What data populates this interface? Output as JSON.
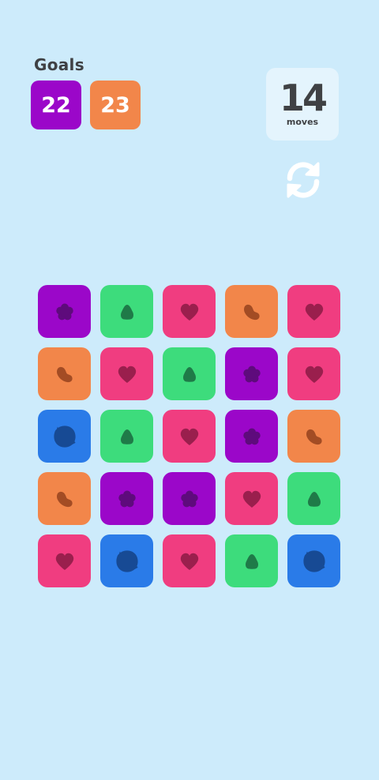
{
  "goals": {
    "label": "Goals",
    "items": [
      {
        "value": "22",
        "color": "#9b07c9"
      },
      {
        "value": "23",
        "color": "#f2864a"
      }
    ]
  },
  "moves": {
    "count": "14",
    "label": "moves"
  },
  "restart": {
    "icon": "restart-icon"
  },
  "colors": {
    "purple": "#9b07c9",
    "green": "#3ddc7c",
    "pink": "#f03d80",
    "orange": "#f2864a",
    "blue": "#2a7be8",
    "background": "#cdebfb"
  },
  "board": {
    "rows": [
      [
        {
          "color": "purple",
          "icon": "flower-icon"
        },
        {
          "color": "green",
          "icon": "drop-icon"
        },
        {
          "color": "pink",
          "icon": "heart-icon"
        },
        {
          "color": "orange",
          "icon": "bean-icon"
        },
        {
          "color": "pink",
          "icon": "heart-icon"
        }
      ],
      [
        {
          "color": "orange",
          "icon": "bean-icon"
        },
        {
          "color": "pink",
          "icon": "heart-icon"
        },
        {
          "color": "green",
          "icon": "drop-icon"
        },
        {
          "color": "purple",
          "icon": "flower-icon"
        },
        {
          "color": "pink",
          "icon": "heart-icon"
        }
      ],
      [
        {
          "color": "blue",
          "icon": "blob-icon"
        },
        {
          "color": "green",
          "icon": "drop-icon"
        },
        {
          "color": "pink",
          "icon": "heart-icon"
        },
        {
          "color": "purple",
          "icon": "flower-icon"
        },
        {
          "color": "orange",
          "icon": "bean-icon"
        }
      ],
      [
        {
          "color": "orange",
          "icon": "bean-icon"
        },
        {
          "color": "purple",
          "icon": "flower-icon"
        },
        {
          "color": "purple",
          "icon": "flower-icon"
        },
        {
          "color": "pink",
          "icon": "heart-icon"
        },
        {
          "color": "green",
          "icon": "drop-icon"
        }
      ],
      [
        {
          "color": "pink",
          "icon": "heart-icon"
        },
        {
          "color": "blue",
          "icon": "blob-icon"
        },
        {
          "color": "pink",
          "icon": "heart-icon"
        },
        {
          "color": "green",
          "icon": "drop-icon"
        },
        {
          "color": "blue",
          "icon": "blob-icon"
        }
      ]
    ]
  }
}
